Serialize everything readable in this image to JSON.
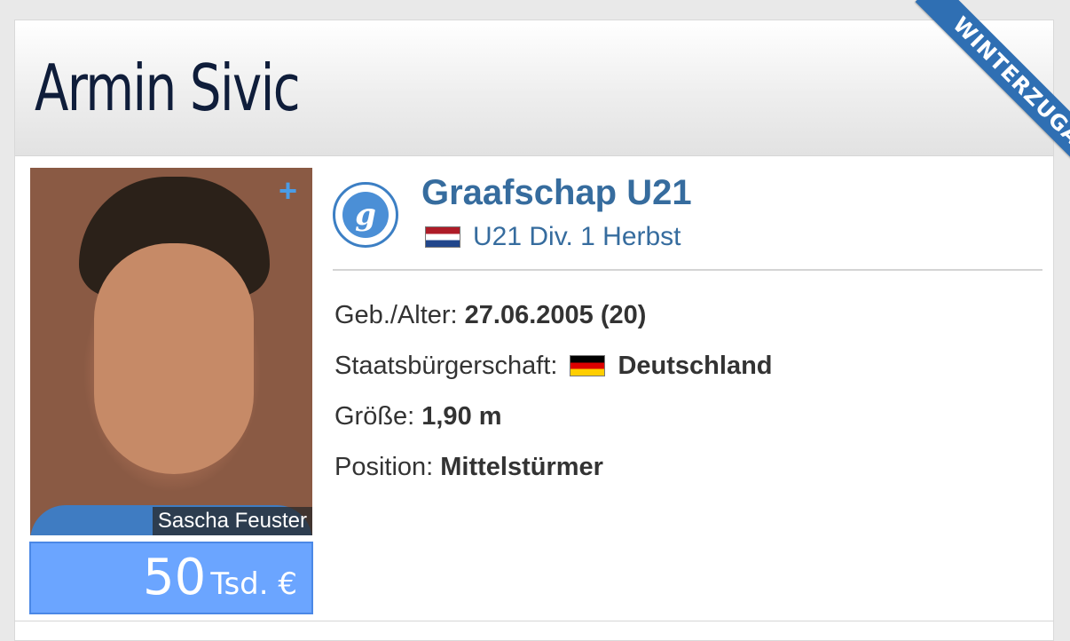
{
  "player": {
    "name": "Armin Sivic",
    "ribbon": "WINTERZUGANG",
    "photo_plus": "+",
    "photo_credit": "Sascha Feuster",
    "market_value_number": "50",
    "market_value_unit": "Tsd. €"
  },
  "club": {
    "name": "Graafschap U21",
    "logo_letter": "g",
    "league": "U21 Div. 1 Herbst",
    "league_flag": "netherlands-flag-icon"
  },
  "info": {
    "birth_label": "Geb./Alter:",
    "birth_value": "27.06.2005 (20)",
    "citizenship_label": "Staatsbürgerschaft:",
    "citizenship_value": "Deutschland",
    "citizenship_flag": "germany-flag-icon",
    "height_label": "Größe:",
    "height_value": "1,90 m",
    "position_label": "Position:",
    "position_value": "Mittelstürmer"
  },
  "colors": {
    "header_text": "#0f1d3a",
    "club_link": "#366c9e",
    "ribbon": "#2f6fb3",
    "market_value_bg": "#6ba5ff"
  }
}
